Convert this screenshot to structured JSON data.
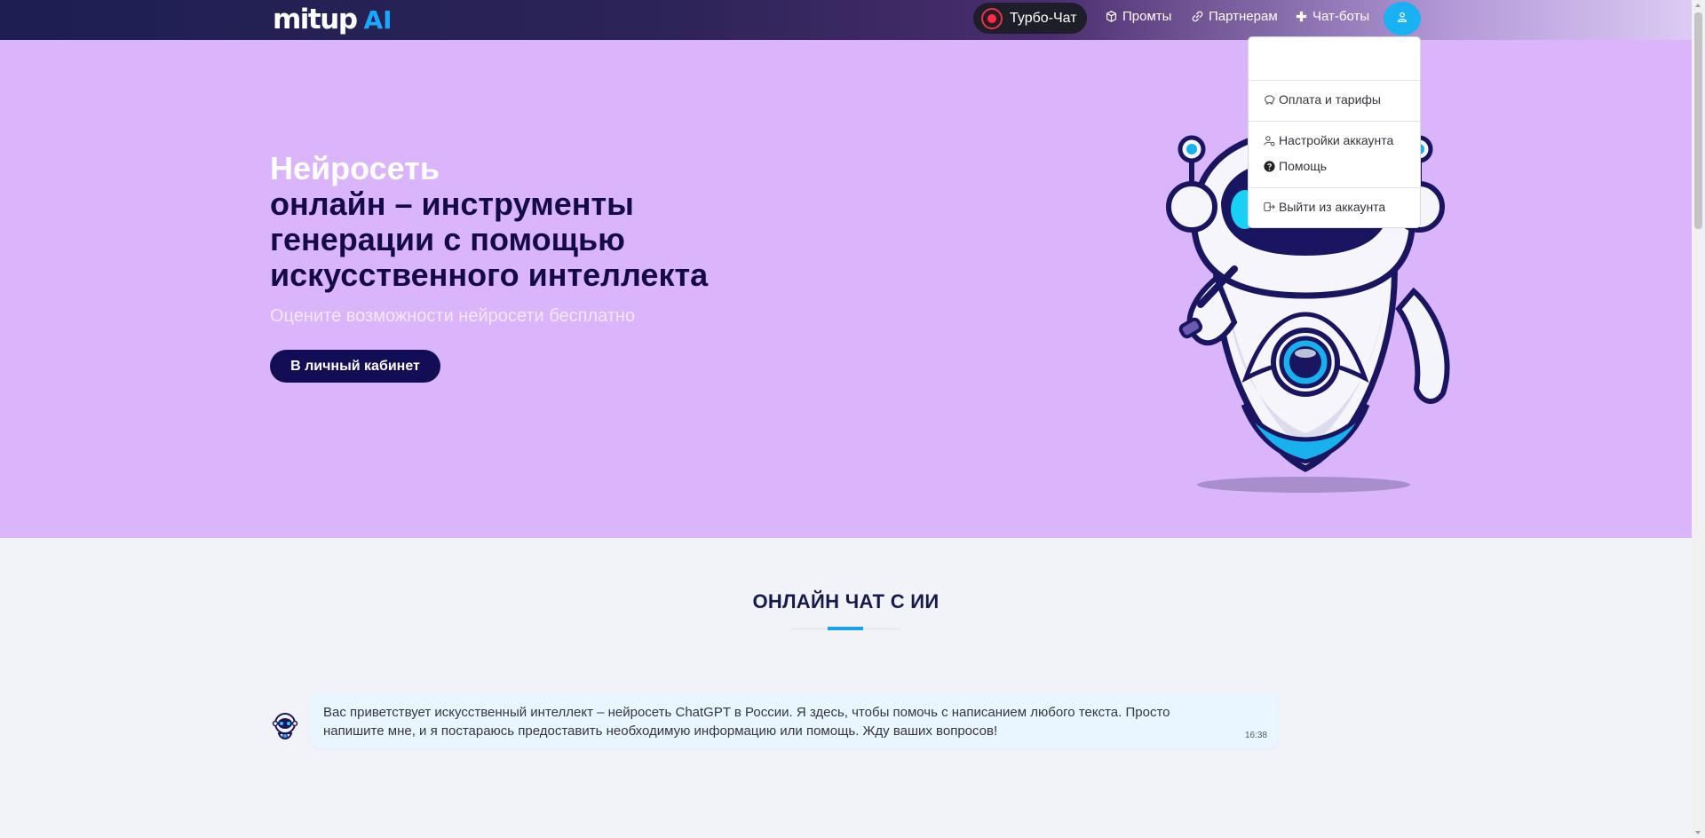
{
  "header": {
    "logo_main": "mitup",
    "logo_ai": "AI",
    "turbo_chat_label": "Турбо-Чат",
    "nav": {
      "prompts": "Промты",
      "partners": "Партнерам",
      "chatbots": "Чат-боты"
    }
  },
  "account_menu": {
    "items": [
      {
        "label": "Оплата и тарифы",
        "icon": "piggy-bank-icon"
      },
      {
        "label": "Настройки аккаунта",
        "icon": "user-gear-icon"
      },
      {
        "label": "Помощь",
        "icon": "question-circle-icon"
      },
      {
        "label": "Выйти из аккаунта",
        "icon": "logout-icon"
      }
    ]
  },
  "hero": {
    "title_highlight": "Нейросеть",
    "title_lines": [
      "онлайн – инструменты",
      "генерации с помощью",
      "искусственного интеллекта"
    ],
    "subtitle": "Оцените возможности нейросети бесплатно",
    "cta_label": "В личный кабинет"
  },
  "chat_section": {
    "title": "ОНЛАЙН ЧАТ С ИИ",
    "messages": [
      {
        "text": "Вас приветствует искусственный интеллект – нейросеть ChatGPT в России. Я здесь, чтобы помочь с написанием любого текста. Просто напишите мне, и я постараюсь предоставить необходимую информацию или помощь. Жду ваших вопросов!",
        "time": "16:38"
      }
    ]
  },
  "colors": {
    "hero_bg": "#dab5fc",
    "accent": "#1aa8ff",
    "dark_navy": "#140a4a",
    "bubble_bg": "#eaf6ff"
  }
}
